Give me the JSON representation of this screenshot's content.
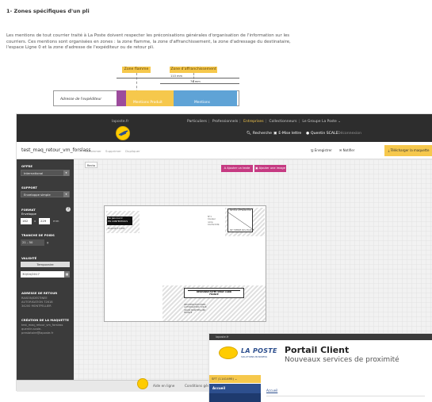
{
  "doc": {
    "title": "1- Zones spécifiques d'un pli",
    "paragraph": "Les mentions de tout courrier traité à La Poste doivent respecter les préconisations générales d'organisation de l'information sur les courriers. Ces mentions sont organisées en zones : la zone flamme, la zone d'affranchissement, la zone d'adressage du destinataire, l'espace Ligne 0 et la zone d'adresse de l'expéditeur ou de retour pli.",
    "diagram": {
      "zone_flamme": "Zone flamme",
      "zone_affranchissement": "Zone d'affranchissement",
      "dim_110": "110 mm",
      "dim_74": "74 mm",
      "adresse_expediteur": "Adresse de l'expéditeur",
      "mentions_produit": "Mentions Produit",
      "mentions": "Mentions"
    }
  },
  "app": {
    "topbar": {
      "site": "laposte.fr",
      "nav": [
        "Particuliers",
        "Professionnels",
        "Entreprises",
        "Collectionneurs",
        "Le Groupe La Poste ⌄"
      ],
      "active_index": 2,
      "search": "Recherche",
      "mailbox": "E-Mise lettre",
      "user": "Quentin SCALE",
      "logout": "Déconnexion"
    },
    "subbar": {
      "project_name": "test_maq_retour_vm_forslass",
      "links": [
        "Renommer",
        "Supprimer",
        "Dupliquer"
      ],
      "save": "Enregistrer",
      "notify": "Notifier",
      "download": "Télécharger la maquette"
    },
    "sidebar": {
      "offre_label": "OFFRE",
      "offre_value": "International",
      "support_label": "SUPPORT",
      "support_value": "Enveloppe simple",
      "format_label": "FORMAT",
      "format_sub": "Enveloppe",
      "width": "162",
      "x": "x",
      "height": "229",
      "unit": "mm",
      "poids_label": "TRANCHE DE POIDS",
      "poids_value": "21 - 50",
      "poids_unit": "g",
      "validite_label": "VALIDITÉ",
      "validite_btn": "Temporaire",
      "date": "30/04/2017",
      "adresse_label": "ADRESSE DE RETOUR",
      "adresse_lines": [
        "RAISON/DESTINEE",
        "AUTORISATION 72618",
        "34200 MONTPELLIER"
      ],
      "creation_label": "CRÉATION DE LA MAQUETTE",
      "creation_lines": [
        "test_maq_retour_vm_forslass",
        "quentin.scale-",
        "prestataire@laposte.fr"
      ]
    },
    "canvas": {
      "tab": "Recto",
      "add_text": "Ajouter un texte",
      "add_image": "Ajouter une image",
      "black_block": "Ne pas ouvrir\nEN CONTENTIOUS",
      "small_left": "DALLOR E-CODE",
      "small_mid": "N°1\nCouleur\nnoire\nConformité",
      "stamp_top": "NE PAS AFFRANCHIR",
      "stamp_bottom": "NE TIMBRE PAS MAROC",
      "postage_line1": "RESPONSE PAYEE VERLY CARD",
      "postage_line2": "FRANCE",
      "address_lines": "RECIPIENT/DESTINEE\nAUTORISATION 72618\n34000 MONTPELLIER\nFRANCE"
    },
    "footer": {
      "site": "Aide en ligne",
      "conditions": "Conditions générales"
    }
  },
  "portal": {
    "top": "laposte.fr",
    "brand": "LA POSTE",
    "brand_sub": "SOLUTIONS BUSINESS",
    "title": "Portail Client",
    "subtitle": "Nouveaux services de proximité",
    "account_select": "SFT (1141495) ⌄",
    "menu_home": "Accueil",
    "breadcrumb": "Accueil"
  }
}
